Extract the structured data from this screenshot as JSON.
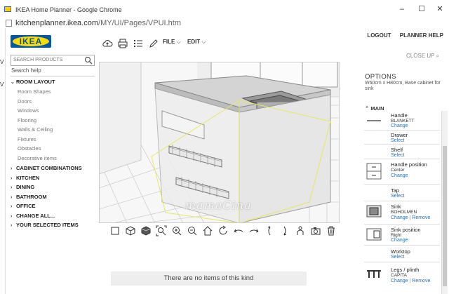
{
  "window": {
    "title": "IKEA Home Planner - Google Chrome",
    "url_host": "kitchenplanner.ikea.com",
    "url_path": "/MY/UI/Pages/VPUI.htm",
    "left_edge_texts": [
      "V",
      "V"
    ]
  },
  "app": {
    "logo_text": "IKEA",
    "menus": {
      "file": "FILE",
      "edit": "EDIT"
    },
    "logout": "LOGOUT",
    "planner_help": "PLANNER HELP",
    "close_up": "CLOSE UP",
    "icons": [
      "cloud-save-icon",
      "print-icon",
      "list-icon",
      "pencil-icon"
    ],
    "brand_colors": {
      "blue": "#0058a3",
      "yellow": "#ffdb00",
      "link": "#2a6fb5"
    }
  },
  "sidebar": {
    "search_placeholder": "SEARCH PRODUCTS",
    "search_help": "Search help",
    "room_layout": "ROOM LAYOUT",
    "room_layout_items": [
      "Room Shapes",
      "Doors",
      "Windows",
      "Flooring",
      "Walls & Ceiling",
      "Fixtures",
      "Obstacles",
      "Decorative items"
    ],
    "categories": [
      "CABINET COMBINATIONS",
      "KITCHEN",
      "DINING",
      "BATHROOM",
      "OFFICE",
      "CHANGE ALL...",
      "YOUR SELECTED ITEMS"
    ]
  },
  "canvas": {
    "watermark": "mamaCina",
    "tools": [
      "box-icon",
      "cube-outline-icon",
      "cube-solid-icon",
      "zoom-fit-icon",
      "zoom-in-icon",
      "zoom-out-icon",
      "home-icon",
      "rotate-icon",
      "arrow-left-icon",
      "arrow-right-icon",
      "rotate-left-icon",
      "rotate-right-icon",
      "person-view-icon",
      "camera-icon",
      "trash-icon"
    ]
  },
  "footer": {
    "no_items": "There are no items of this kind"
  },
  "options": {
    "title": "OPTIONS",
    "description": "W60cm x H80cm, Base cabinet for sink",
    "main_label": "MAIN",
    "items": [
      {
        "name": "Handle",
        "value": "BLANKETT",
        "action": "Change",
        "action2": ""
      },
      {
        "name": "Drawer",
        "value": "",
        "action": "Select",
        "action2": ""
      },
      {
        "name": "Shelf",
        "value": "",
        "action": "Select",
        "action2": ""
      },
      {
        "name": "Handle position",
        "value": "Center",
        "action": "Change",
        "action2": ""
      },
      {
        "name": "Tap",
        "value": "",
        "action": "Select",
        "action2": ""
      },
      {
        "name": "Sink",
        "value": "BOHOLMEN",
        "action": "Change",
        "action2": "Remove"
      },
      {
        "name": "Sink position",
        "value": "Right",
        "action": "Change",
        "action2": ""
      },
      {
        "name": "Worktop",
        "value": "",
        "action": "Select",
        "action2": ""
      },
      {
        "name": "Legs / plinth",
        "value": "CAPITA",
        "action": "Change",
        "action2": "Remove"
      }
    ]
  }
}
